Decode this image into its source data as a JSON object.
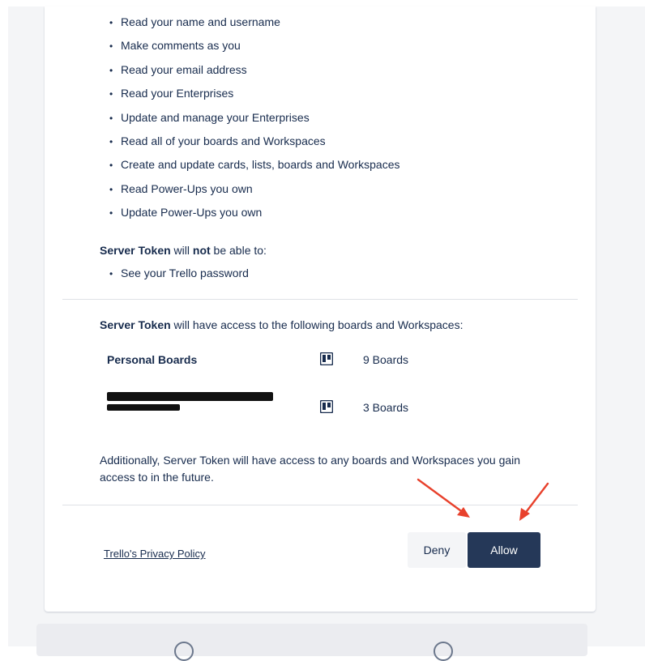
{
  "permissions": {
    "granted": [
      "Read your name and username",
      "Make comments as you",
      "Read your email address",
      "Read your Enterprises",
      "Update and manage your Enterprises",
      "Read all of your boards and Workspaces",
      "Create and update cards, lists, boards and Workspaces",
      "Read Power-Ups you own",
      "Update Power-Ups you own"
    ],
    "not_heading": {
      "app": "Server Token",
      "middle": " will ",
      "emphasis": "not",
      "tail": " be able to:"
    },
    "not_granted": [
      "See your Trello password"
    ]
  },
  "access": {
    "heading": {
      "app": "Server Token",
      "tail": " will have access to the following boards and Workspaces:"
    },
    "boards": [
      {
        "name": "Personal Boards",
        "count": "9 Boards",
        "icon": "board-icon"
      },
      {
        "name": "",
        "count": "3 Boards",
        "icon": "board-icon",
        "redacted": true
      }
    ],
    "additional": "Additionally, Server Token will have access to any boards and Workspaces you gain access to in the future."
  },
  "footer": {
    "privacy_link": "Trello's Privacy Policy",
    "deny_label": "Deny",
    "allow_label": "Allow"
  },
  "colors": {
    "allow_bg": "#253858",
    "deny_bg": "#f4f5f7",
    "annotation_arrow": "#e8412c",
    "text": "#172b4d"
  }
}
